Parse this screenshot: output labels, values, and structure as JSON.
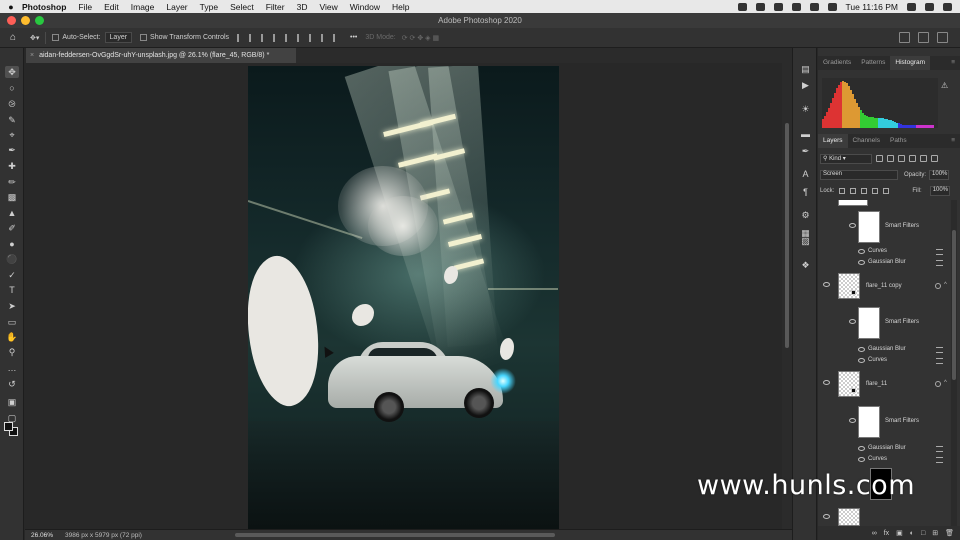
{
  "menubar": {
    "app_name": "Photoshop",
    "items": [
      "File",
      "Edit",
      "Image",
      "Layer",
      "Type",
      "Select",
      "Filter",
      "3D",
      "View",
      "Window",
      "Help"
    ],
    "clock": "Tue 11:16 PM"
  },
  "titlebar": {
    "title": "Adobe Photoshop 2020"
  },
  "options": {
    "auto_select_label": "Auto-Select:",
    "auto_select_value": "Layer",
    "transform_label": "Show Transform Controls",
    "mode_3d": "3D Mode:"
  },
  "document": {
    "tab_title": "aidan-feddersen-OvGgdSr-uhY-unsplash.jpg @ 26.1% (flare_45, RGB/8) *",
    "zoom": "26.06%",
    "info": "3986 px x 5979 px (72 ppi)"
  },
  "panels": {
    "top_tabs": [
      "Gradients",
      "Patterns",
      "Histogram"
    ],
    "top_active": "Histogram",
    "layer_tabs": [
      "Layers",
      "Channels",
      "Paths"
    ],
    "kind_label": "Kind",
    "blend_mode": "Screen",
    "opacity_label": "Opacity:",
    "opacity_value": "100%",
    "lock_label": "Lock:",
    "fill_label": "Fill:",
    "fill_value": "100%"
  },
  "layers": {
    "rows": [
      {
        "type": "smart",
        "label": "Smart Filters"
      },
      {
        "type": "filter",
        "label": "Curves"
      },
      {
        "type": "filter",
        "label": "Gaussian Blur"
      },
      {
        "type": "layer",
        "label": "flare_11 copy"
      },
      {
        "type": "smart",
        "label": "Smart Filters"
      },
      {
        "type": "filter",
        "label": "Gaussian Blur"
      },
      {
        "type": "filter",
        "label": "Curves"
      },
      {
        "type": "layer",
        "label": "flare_11"
      },
      {
        "type": "smart",
        "label": "Smart Filters"
      },
      {
        "type": "filter",
        "label": "Gaussian Blur"
      },
      {
        "type": "filter",
        "label": "Curves"
      }
    ]
  },
  "watermark": "www.hunls.com",
  "colors": {
    "accent": "#48d6ff",
    "panel_bg": "#323232",
    "canvas_bg": "#282828"
  }
}
